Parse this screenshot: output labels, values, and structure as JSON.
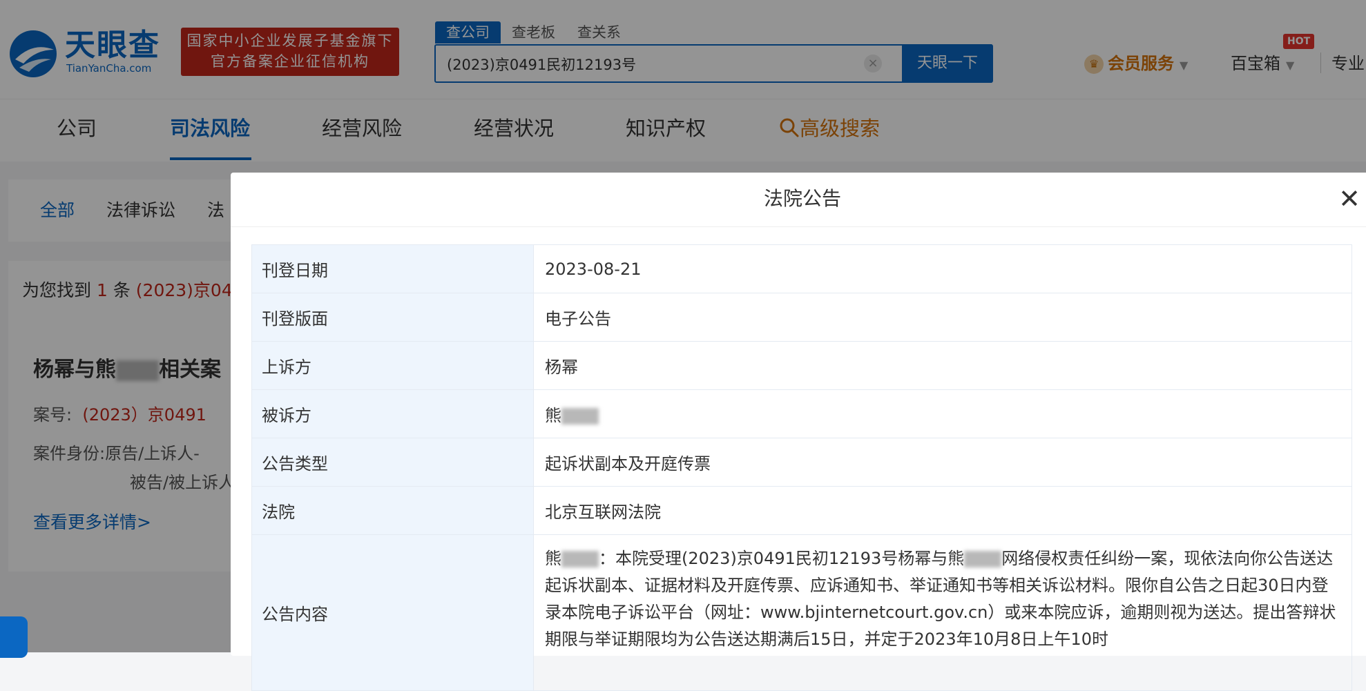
{
  "header": {
    "logo_cn": "天眼查",
    "logo_en": "TianYanCha.com",
    "badge_line1": "国家中小企业发展子基金旗下",
    "badge_line2": "官方备案企业征信机构",
    "search_tabs": [
      "查公司",
      "查老板",
      "查关系"
    ],
    "search_value": "(2023)京0491民初12193号",
    "search_button": "天眼一下",
    "member_label": "会员服务",
    "baobox_label": "百宝箱",
    "hot_badge": "HOT",
    "pro_label": "专业"
  },
  "nav": {
    "items": [
      "公司",
      "司法风险",
      "经营风险",
      "经营状况",
      "知识产权"
    ],
    "advanced": "高级搜索"
  },
  "subtabs": [
    "全部",
    "法律诉讼",
    "法"
  ],
  "results": {
    "found_prefix": "为您找到",
    "found_count": "1",
    "found_unit": "条",
    "found_query": "(2023)京04",
    "case_title_a": "杨幂与熊",
    "case_title_b": "相关案",
    "case_no_label": "案号:",
    "case_no_value": "(2023）京0491",
    "identity_label": "案件身份:",
    "identity_value1": "原告/上诉人-",
    "identity_value2": "被告/被上诉人",
    "more_link": "查看更多详情",
    "more_chevron": ">"
  },
  "modal": {
    "title": "法院公告",
    "rows": [
      {
        "key": "刊登日期",
        "value": "2023-08-21"
      },
      {
        "key": "刊登版面",
        "value": "电子公告"
      },
      {
        "key": "上诉方",
        "value": "杨幂"
      },
      {
        "key": "被诉方",
        "value": "熊"
      },
      {
        "key": "公告类型",
        "value": "起诉状副本及开庭传票"
      },
      {
        "key": "法院",
        "value": "北京互联网法院"
      }
    ],
    "content_key": "公告内容",
    "content_p1": "熊",
    "content_p2": "：本院受理(2023)京0491民初12193号杨幂与熊",
    "content_p3": "网络侵权责任纠纷一案，现依法向你公告送达起诉状副本、证据材料及开庭传票、应诉通知书、举证通知书等相关诉讼材料。限你自公告之日起30日内登录本院电子诉讼平台（网址：www.bjinternetcourt.gov.cn）或来本院应诉，逾期则视为送达。提出答辩状期限与举证期限均为公告送达期满后15日，并定于2023年10月8日上午10时"
  },
  "icons": {
    "close": "close-icon",
    "search": "search-icon",
    "crown": "crown-icon",
    "chat": "chat-icon"
  },
  "colors": {
    "brand_blue": "#0b67c2",
    "brand_red": "#c1261a",
    "accent_orange": "#d4730b"
  }
}
